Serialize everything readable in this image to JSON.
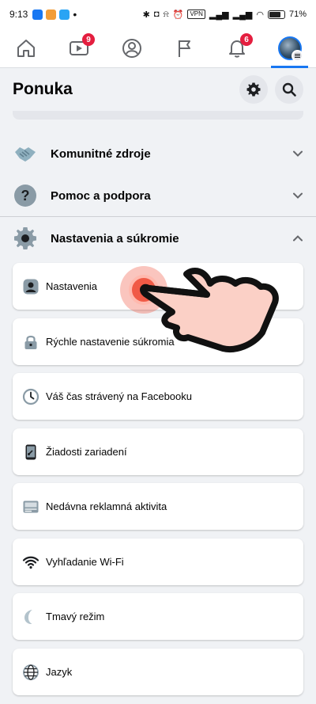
{
  "status_bar": {
    "time": "9:13",
    "vpn": "VPN",
    "battery": "71",
    "battery_unit": "%"
  },
  "nav": {
    "items": [
      {
        "name": "home",
        "icon": "home-icon"
      },
      {
        "name": "watch",
        "icon": "video-icon",
        "badge": "9"
      },
      {
        "name": "profile",
        "icon": "profile-icon"
      },
      {
        "name": "pages",
        "icon": "flag-icon"
      },
      {
        "name": "notifications",
        "icon": "bell-icon",
        "badge": "6"
      },
      {
        "name": "menu",
        "icon": "avatar",
        "active": true
      }
    ]
  },
  "header": {
    "title": "Ponuka",
    "settings_icon": "gear-icon",
    "search_icon": "search-icon"
  },
  "sections": [
    {
      "label": "Komunitné zdroje",
      "icon": "handshake-icon",
      "expanded": false
    },
    {
      "label": "Pomoc a podpora",
      "icon": "help-icon",
      "expanded": false
    },
    {
      "label": "Nastavenia a súkromie",
      "icon": "gear-icon",
      "expanded": true
    }
  ],
  "settings_items": [
    {
      "label": "Nastavenia",
      "icon": "user-settings-icon"
    },
    {
      "label": "Rýchle nastavenie súkromia",
      "icon": "lock-icon"
    },
    {
      "label": "Váš čas strávený na Facebooku",
      "icon": "clock-icon"
    },
    {
      "label": "Žiadosti zariadení",
      "icon": "phone-icon"
    },
    {
      "label": "Nedávna reklamná aktivita",
      "icon": "ad-activity-icon"
    },
    {
      "label": "Vyhľadanie Wi-Fi",
      "icon": "wifi-icon"
    },
    {
      "label": "Tmavý režim",
      "icon": "moon-icon"
    },
    {
      "label": "Jazyk",
      "icon": "globe-icon"
    }
  ],
  "colors": {
    "accent": "#1877f2",
    "badge": "#e41e3f",
    "background": "#f0f2f5",
    "tap": "#f05a46"
  }
}
